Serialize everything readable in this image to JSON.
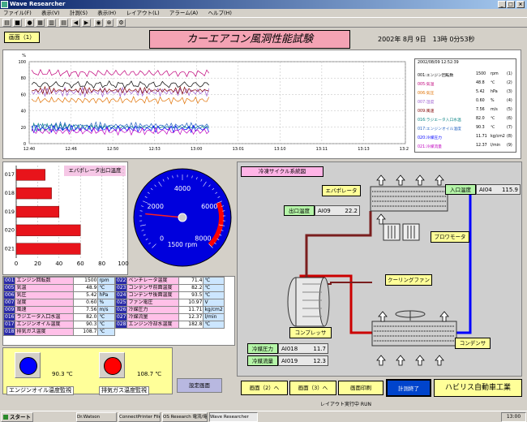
{
  "window": {
    "title": "Wave Researcher",
    "minimize": "_",
    "maximize": "□",
    "close": "×"
  },
  "menu": [
    "ファイル(F)",
    "表示(V)",
    "計測(S)",
    "表示(H)",
    "レイアウト(L)",
    "アラーム(A)",
    "ヘルプ(H)"
  ],
  "toolbar": {
    "icons": [
      "open-icon",
      "save-icon",
      "stop-icon",
      "print-icon",
      "graph-icon",
      "back-icon",
      "forward-icon",
      "record-icon",
      "settings-icon"
    ]
  },
  "screen_label": "画面（1）",
  "main_title": "カーエアコン風洞性能試験",
  "datetime": "2002年 8月 9日　13時 0分53秒",
  "trend": {
    "y_ticks": [
      "100",
      "80",
      "60",
      "40",
      "20",
      "0"
    ],
    "y_unit": "%",
    "x_ticks": [
      "12:40",
      "12:46",
      "12:50",
      "12:53",
      "13:00",
      "13:01",
      "13:10",
      "13:11",
      "13:13",
      "13:20"
    ],
    "x_label": "時間",
    "legend_header": "2002/08/09 12:52:39",
    "legend": [
      {
        "id": "001",
        "name": "エンジン回転数",
        "value": "1500",
        "unit": "rpm",
        "no": "(1)",
        "color": "#000000"
      },
      {
        "id": "005",
        "name": "気温",
        "value": "48.8",
        "unit": "℃",
        "no": "(2)",
        "color": "#c0007a"
      },
      {
        "id": "006",
        "name": "気圧",
        "value": "5.42",
        "unit": "hPa",
        "no": "(3)",
        "color": "#e07000"
      },
      {
        "id": "007",
        "name": "湿度",
        "value": "0.60",
        "unit": "%",
        "no": "(4)",
        "color": "#9c5cd0"
      },
      {
        "id": "009",
        "name": "風速",
        "value": "7.56",
        "unit": "m/s",
        "no": "(5)",
        "color": "#800000"
      },
      {
        "id": "016",
        "name": "ラジエータ入口水温",
        "value": "82.0",
        "unit": "℃",
        "no": "(6)",
        "color": "#008080"
      },
      {
        "id": "017",
        "name": "エンジンオイル温度",
        "value": "90.3",
        "unit": "℃",
        "no": "(7)",
        "color": "#2060c0"
      },
      {
        "id": "020",
        "name": "冷媒圧力",
        "value": "11.71",
        "unit": "kg/cm2",
        "no": "(8)",
        "color": "#0000ff"
      },
      {
        "id": "021",
        "name": "冷媒流量",
        "value": "12.37",
        "unit": "l/min",
        "no": "(9)",
        "color": "#c000c0"
      }
    ]
  },
  "bar_chart": {
    "title": "エバポレータ出口温度",
    "categories": [
      "017",
      "018",
      "019",
      "020",
      "021"
    ],
    "values": [
      27,
      33,
      40,
      60,
      60
    ],
    "xlim": [
      0,
      100
    ],
    "x_ticks": [
      "0",
      "20",
      "40",
      "60",
      "80",
      "100"
    ],
    "color": "#e8141b"
  },
  "gauge": {
    "ticks": [
      "0",
      "2000",
      "4000",
      "6000",
      "8000"
    ],
    "value": "1500",
    "unit": "rpm",
    "max": 8000,
    "level": 1500,
    "redzone_start": 6000
  },
  "data_table": {
    "left": [
      {
        "id": "001",
        "name": "エンジン回転数",
        "value": "1500",
        "unit": "rpm"
      },
      {
        "id": "005",
        "name": "気温",
        "value": "48.9",
        "unit": "℃"
      },
      {
        "id": "006",
        "name": "気圧",
        "value": "5.42",
        "unit": "hPa"
      },
      {
        "id": "007",
        "name": "湿度",
        "value": "0.60",
        "unit": "%"
      },
      {
        "id": "009",
        "name": "風速",
        "value": "7.56",
        "unit": "m/s"
      },
      {
        "id": "016",
        "name": "ラジエータ入口水温",
        "value": "82.0",
        "unit": "℃"
      },
      {
        "id": "017",
        "name": "エンジンオイル温度",
        "value": "90.3",
        "unit": "℃"
      },
      {
        "id": "018",
        "name": "排気ガス温度",
        "value": "108.7",
        "unit": "℃"
      }
    ],
    "right": [
      {
        "id": "022",
        "name": "ベンチレータ温度",
        "value": "71.4",
        "unit": "℃"
      },
      {
        "id": "023",
        "name": "コンデンサ前面温度",
        "value": "82.2",
        "unit": "℃"
      },
      {
        "id": "024",
        "name": "コンデンサ後面温度",
        "value": "93.5",
        "unit": "℃"
      },
      {
        "id": "025",
        "name": "ファン電圧",
        "value": "10.97",
        "unit": "V"
      },
      {
        "id": "026",
        "name": "冷媒圧力",
        "value": "11.71",
        "unit": "kg/cm2"
      },
      {
        "id": "027",
        "name": "冷媒流量",
        "value": "12.37",
        "unit": "l/min"
      },
      {
        "id": "028",
        "name": "エンジン冷却水温度",
        "value": "182.8",
        "unit": "℃"
      }
    ]
  },
  "lamps": [
    {
      "label": "エンジンオイル温度監視",
      "value": "90.3 ℃",
      "color": "#0000ff"
    },
    {
      "label": "排気ガス温度監視",
      "value": "108.7 ℃",
      "color": "#ff0000"
    }
  ],
  "cycle": {
    "title": "冷凍サイクル系統図",
    "evaporator": "エバポレータ",
    "blower": "ブロワモータ",
    "cooling_fan": "クーリングファン",
    "compressor": "コンプレッサ",
    "condenser": "コンデンサ",
    "inlet_label": "入口温度",
    "inlet_id": "AI04",
    "inlet_value": "115.9",
    "outlet_label": "出口温度",
    "outlet_id": "AI09",
    "outlet_value": "22.2",
    "pressure_label": "冷媒圧力",
    "pressure_id": "AI018",
    "pressure_value": "11.7",
    "flow_label": "冷媒流量",
    "flow_id": "AI019",
    "flow_value": "12.3"
  },
  "buttons": {
    "mid": "設定画面",
    "screen2": "画面（2）へ",
    "screen3": "画面（3）へ",
    "print": "画面印刷",
    "end": "計測終了",
    "company": "ハビリス自動車工業"
  },
  "statusbar": "レイアウト実行中   RUN",
  "taskbar": {
    "start": "スタート",
    "tasks": [
      "Dr.Watson",
      "ConnectPrinter FileWave",
      "OS Research 電流/電圧",
      "Wave Researcher"
    ],
    "clock": "13:00"
  }
}
